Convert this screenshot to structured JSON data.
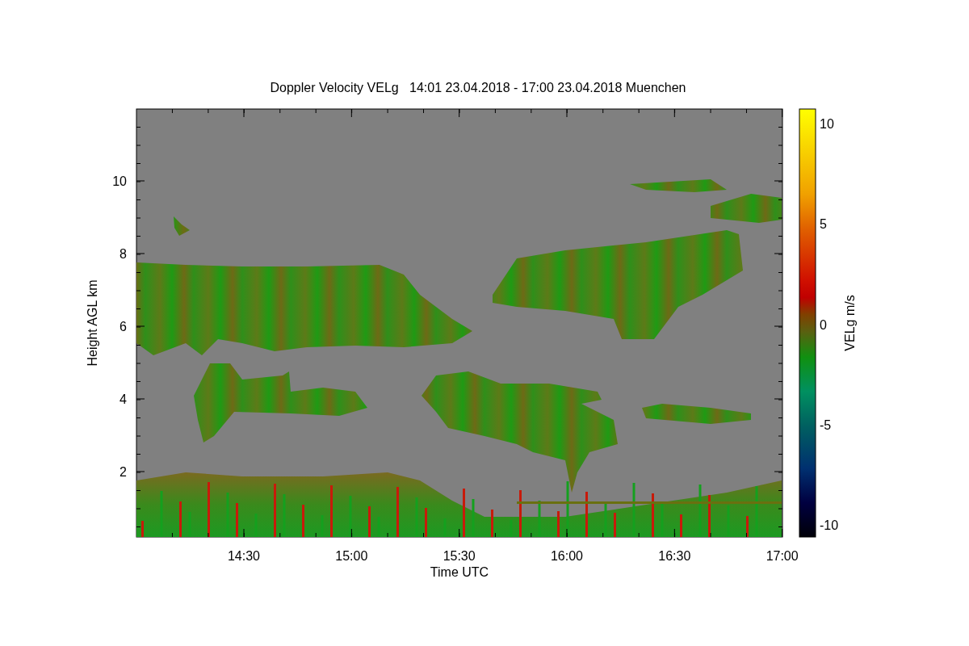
{
  "title": "Doppler Velocity VELg   14:01 23.04.2018 - 17:00 23.04.2018 Muenchen",
  "x_axis": {
    "label": "Time UTC",
    "ticks": [
      "14:30",
      "15:00",
      "15:30",
      "16:00",
      "16:30",
      "17:00"
    ]
  },
  "y_axis": {
    "label": "Height AGL km",
    "ticks": [
      "10",
      "8",
      "6",
      "4",
      "2"
    ]
  },
  "colorbar": {
    "label": "VELg m/s",
    "ticks": [
      "10",
      "5",
      "0",
      "-5",
      "-10"
    ]
  }
}
